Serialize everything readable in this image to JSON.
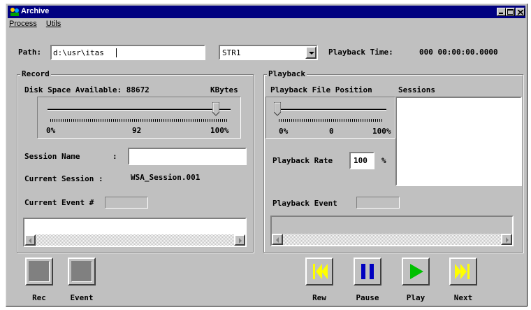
{
  "window": {
    "title": "Archive"
  },
  "menu": [
    "Process",
    "Utils"
  ],
  "path": {
    "label": "Path:",
    "value": "d:\\usr\\itas"
  },
  "stream": {
    "selected": "STR1"
  },
  "playback_time": {
    "label": "Playback Time:",
    "value": "000 00:00:00.0000"
  },
  "record": {
    "title": "Record",
    "disk_label": "Disk Space Available: 88672",
    "disk_unit": "KBytes",
    "slider": {
      "min_label": "0%",
      "mid_label": "92",
      "max_label": "100%",
      "value_percent": 92
    },
    "session_name_label": "Session Name",
    "session_name_colon": ":",
    "session_name_value": "",
    "current_session_label": "Current Session :",
    "current_session_value": "WSA_Session.001",
    "current_event_label": "Current Event #",
    "current_event_value": "",
    "buttons": {
      "rec": "Rec",
      "event": "Event"
    }
  },
  "playback": {
    "title": "Playback",
    "file_position_label": "Playback File Position",
    "sessions_label": "Sessions",
    "slider": {
      "min_label": "0%",
      "mid_label": "0",
      "max_label": "100%",
      "value_percent": 0
    },
    "rate_label": "Playback Rate",
    "rate_value": "100",
    "rate_unit": "%",
    "event_label": "Playback Event",
    "event_value": "",
    "buttons": {
      "rew": "Rew",
      "pause": "Pause",
      "play": "Play",
      "next": "Next"
    }
  },
  "colors": {
    "face": "#c0c0c0",
    "titlebar": "#000080",
    "media_yellow": "#ffff00",
    "media_blue": "#0000c0",
    "media_green": "#00c000"
  }
}
